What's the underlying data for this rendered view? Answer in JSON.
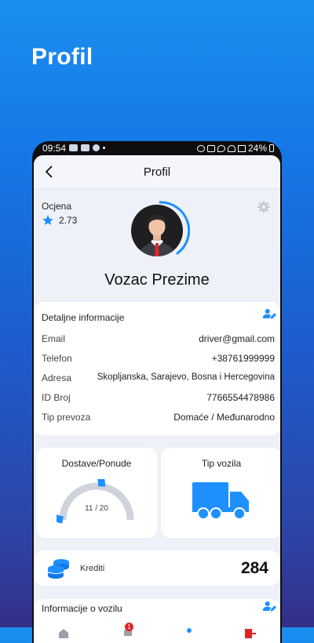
{
  "promo": {
    "title": "Profil"
  },
  "status_bar": {
    "time": "09:54",
    "battery": "24%"
  },
  "app_bar": {
    "title": "Profil"
  },
  "rating": {
    "label": "Ocjena",
    "value": "2.73"
  },
  "user": {
    "name": "Vozac Prezime"
  },
  "details": {
    "title": "Detaljne informacije",
    "rows": [
      {
        "label": "Email",
        "value": "driver@gmail.com"
      },
      {
        "label": "Telefon",
        "value": "+38761999999"
      },
      {
        "label": "Adresa",
        "value": "Skopljanska, Sarajevo, Bosna i Hercegovina"
      },
      {
        "label": "ID Broj",
        "value": "7766554478986"
      },
      {
        "label": "Tip prevoza",
        "value": "Domaće / Međunarodno"
      }
    ]
  },
  "deliveries": {
    "title": "Dostave/Ponude",
    "value_text": "11 / 20",
    "done": 11,
    "total": 20
  },
  "vehicle_type": {
    "title": "Tip vozila",
    "icon": "truck-icon"
  },
  "credits": {
    "label": "Krediti",
    "value": "284"
  },
  "vehicle_info": {
    "title": "Informacije o vozilu"
  },
  "bottom_nav": {
    "badge": "1"
  },
  "colors": {
    "accent": "#1e90ff",
    "gauge_track": "#cfd4db",
    "background_top": "#1b8ef0",
    "background_bottom": "#332f86"
  }
}
